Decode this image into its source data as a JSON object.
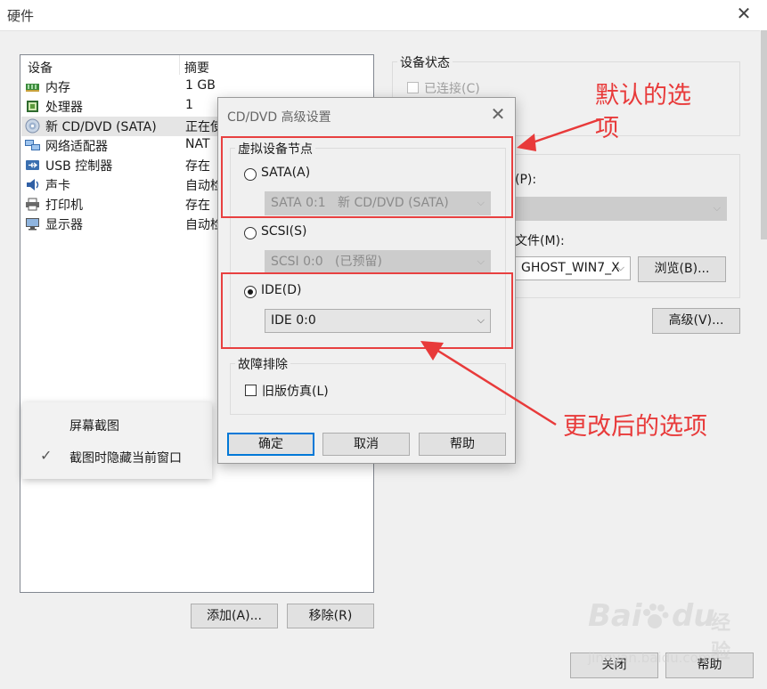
{
  "window": {
    "title": "硬件"
  },
  "device_table": {
    "headers": [
      "设备",
      "摘要"
    ],
    "rows": [
      {
        "name": "内存",
        "summary": "1 GB",
        "icon": "memory-icon"
      },
      {
        "name": "处理器",
        "summary": "1",
        "icon": "processor-icon"
      },
      {
        "name": "新 CD/DVD (SATA)",
        "summary": "正在使",
        "icon": "cd-dvd-icon",
        "selected": true
      },
      {
        "name": "网络适配器",
        "summary": "NAT",
        "icon": "network-adapter-icon"
      },
      {
        "name": "USB 控制器",
        "summary": "存在",
        "icon": "usb-icon"
      },
      {
        "name": "声卡",
        "summary": "自动检",
        "icon": "sound-card-icon"
      },
      {
        "name": "打印机",
        "summary": "存在",
        "icon": "printer-icon"
      },
      {
        "name": "显示器",
        "summary": "自动检",
        "icon": "monitor-icon"
      }
    ]
  },
  "buttons": {
    "add": "添加(A)...",
    "remove": "移除(R)",
    "close": "关闭",
    "help": "帮助",
    "advanced": "高级(V)...",
    "browse": "浏览(B)..."
  },
  "device_status": {
    "label": "设备状态",
    "connected": "已连接(C)"
  },
  "connection_partial": {
    "label_suffix": "(P):",
    "iso_label_suffix": "文件(M):",
    "iso_value": "GHOST_WIN7_X"
  },
  "context_menu": {
    "items": [
      {
        "label": "屏幕截图",
        "checked": false
      },
      {
        "label": "截图时隐藏当前窗口",
        "checked": true
      }
    ]
  },
  "dialog": {
    "title": "CD/DVD 高级设置",
    "node_group": "虚拟设备节点",
    "options": [
      {
        "label": "SATA(A)",
        "selected": false,
        "combo": "SATA 0:1   新 CD/DVD (SATA)",
        "combo_enabled": false
      },
      {
        "label": "SCSI(S)",
        "selected": false,
        "combo": "SCSI 0:0   (已预留)",
        "combo_enabled": false
      },
      {
        "label": "IDE(D)",
        "selected": true,
        "combo": "IDE 0:0",
        "combo_enabled": true
      }
    ],
    "troubleshoot_group": "故障排除",
    "legacy_emulation": "旧版仿真(L)",
    "ok": "确定",
    "cancel": "取消",
    "help": "帮助"
  },
  "annotations": {
    "default_option": [
      "默认的选",
      "项"
    ],
    "changed_option": "更改后的选项"
  },
  "watermark": {
    "brand": "Bai",
    "brand2": "du",
    "cn": "经验",
    "url": "jingyan.baidu.com"
  },
  "colors": {
    "annotation_red": "#e83a3a",
    "selection": "#e5e5e5",
    "default_button_border": "#0078d7"
  }
}
